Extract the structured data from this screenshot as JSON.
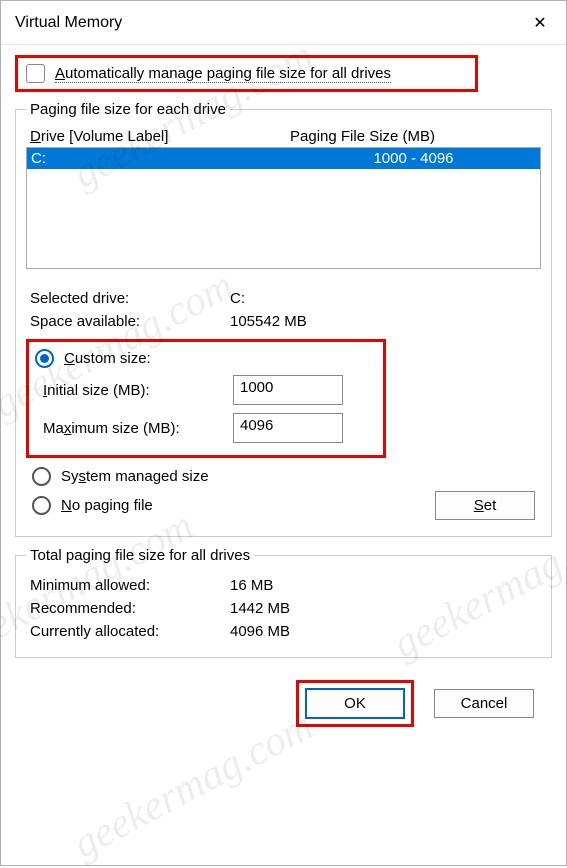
{
  "window": {
    "title": "Virtual Memory",
    "close": "✕"
  },
  "auto_manage": {
    "label_pre": "A",
    "label_rest": "utomatically manage paging file size for all drives"
  },
  "per_drive": {
    "legend": "Paging file size for each drive",
    "col_drive_pre": "D",
    "col_drive_rest": "rive  [Volume Label]",
    "col_size": "Paging File Size (MB)",
    "rows": [
      {
        "drive": "C:",
        "size": "1000 - 4096"
      }
    ],
    "selected_label": "Selected drive:",
    "selected_value": "C:",
    "space_label": "Space available:",
    "space_value": "105542 MB",
    "custom_pre": "C",
    "custom_rest": "ustom size:",
    "initial_pre": "I",
    "initial_rest": "nitial size (MB):",
    "initial_value": "1000",
    "max_label": "Ma",
    "max_pre": "x",
    "max_rest": "imum size (MB):",
    "max_value": "4096",
    "system_pre": "Sy",
    "system_u": "s",
    "system_rest": "tem managed size",
    "nopage_pre": "N",
    "nopage_rest": "o paging file",
    "set_pre": "S",
    "set_rest": "et"
  },
  "totals": {
    "legend": "Total paging file size for all drives",
    "min_label": "Minimum allowed:",
    "min_value": "16 MB",
    "rec_label": "Recommended:",
    "rec_value": "1442 MB",
    "cur_label": "Currently allocated:",
    "cur_value": "4096 MB"
  },
  "actions": {
    "ok": "OK",
    "cancel": "Cancel"
  },
  "watermark": "geekermag.com"
}
